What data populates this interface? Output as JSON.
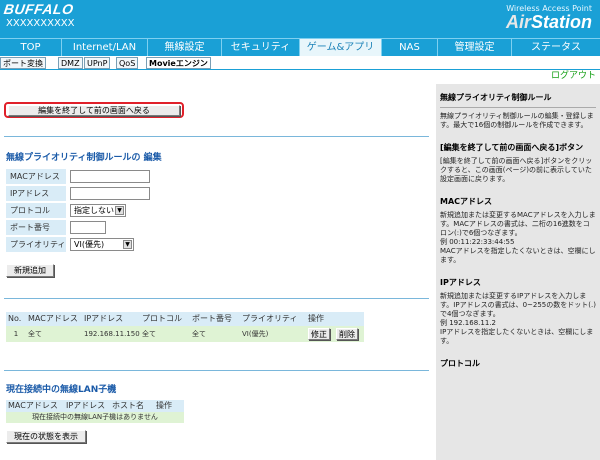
{
  "header": {
    "logo": "BUFFALO",
    "serial": "XXXXXXXXXX",
    "wap_label": "Wireless Access Point",
    "brand_prefix": "Air",
    "brand_suffix": "Station"
  },
  "main_nav": [
    "TOP",
    "Internet/LAN",
    "無線設定",
    "セキュリティ",
    "ゲーム&アプリ",
    "NAS",
    "管理設定",
    "ステータス"
  ],
  "sub_nav": [
    "ポート変換",
    "DMZ",
    "UPnP",
    "QoS",
    "Movieエンジン"
  ],
  "logout": "ログアウト",
  "back_button": "編集を終了して前の画面へ戻る",
  "edit_section": {
    "title": "無線プライオリティ制御ルールの 編集",
    "labels": [
      "MACアドレス",
      "IPアドレス",
      "プロトコル",
      "ポート番号",
      "プライオリティ"
    ],
    "mac_value": "",
    "ip_value": "",
    "protocol_value": "指定しない",
    "port_value": "",
    "priority_value": "VI(優先)",
    "add_button": "新規追加"
  },
  "rules_table": {
    "headers": [
      "No.",
      "MACアドレス",
      "IPアドレス",
      "プロトコル",
      "ポート番号",
      "プライオリティ",
      "操作"
    ],
    "rows": [
      {
        "no": "1",
        "mac": "全て",
        "ip": "192.168.11.150",
        "protocol": "全て",
        "port": "全て",
        "priority": "VI(優先)",
        "edit": "修正",
        "delete": "削除"
      }
    ]
  },
  "clients_section": {
    "title": "現在接続中の無線LAN子機",
    "headers": [
      "MACアドレス",
      "IPアドレス",
      "ホスト名",
      "操作"
    ],
    "empty": "現在接続中の無線LAN子機はありません",
    "status_button": "現在の状態を表示"
  },
  "help": [
    {
      "title": "無線プライオリティ制御ルール",
      "text": "無線プライオリティ制御ルールの編集・登録します。最大で16個の制御ルールを作成できます。"
    },
    {
      "title": "[編集を終了して前の画面へ戻る]ボタン",
      "text": "[編集を終了して前の画面へ戻る]ボタンをクリックすると、この画面(ページ)の前に表示していた設定画面に戻ります。"
    },
    {
      "title": "MACアドレス",
      "text": "新規追加または変更するMACアドレスを入力します。MACアドレスの書式は、二桁の16進数をコロン(:)で6個つなぎます。\n例 00:11:22:33:44:55\nMACアドレスを指定したくないときは、空欄にします。"
    },
    {
      "title": "IPアドレス",
      "text": "新規追加または変更するIPアドレスを入力します。IPアドレスの書式は、0~255の数をドット(.)で4個つなぎます。\n例 192.168.11.2\nIPアドレスを指定したくないときは、空欄にします。"
    },
    {
      "title": "プロトコル",
      "text": ""
    }
  ],
  "colors": {
    "header_bg": "#1aa0d6",
    "highlight_border": "#e0202a",
    "section_title": "#1a5aa8",
    "logout": "#18a018",
    "row_green": "#dff3d4",
    "label_blue": "#d9ecf7"
  }
}
